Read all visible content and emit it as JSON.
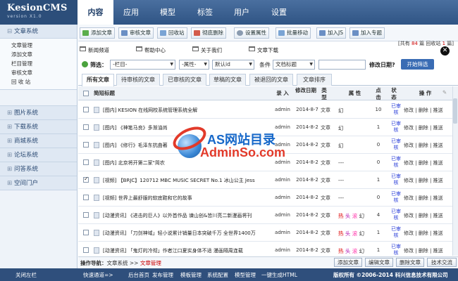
{
  "app": {
    "name": "KesionCMS",
    "version": "version X1.0"
  },
  "nav": {
    "tabs": [
      "内容",
      "应用",
      "模型",
      "标签",
      "用户",
      "设置"
    ],
    "active": "内容"
  },
  "sidebar": {
    "sections": [
      {
        "label": "文章系统",
        "items": [
          "文章管理",
          "添加文章",
          "栏目管理",
          "审核文章",
          "回 收 站"
        ]
      },
      {
        "label": "图片系统"
      },
      {
        "label": "下载系统"
      },
      {
        "label": "商城系统"
      },
      {
        "label": "论坛系统"
      },
      {
        "label": "问答系统"
      },
      {
        "label": "空间门户"
      }
    ]
  },
  "toolbar": {
    "buttons": [
      "添加文章",
      "审核文章",
      "回收站",
      "彻底删除",
      "设置属性",
      "批量移动",
      "加入JS",
      "加入专题"
    ],
    "stats": {
      "pre": "[共有 ",
      "total": "84",
      "mid": " 篇 回收站 ",
      "recycle": "1",
      "post": " 篇]"
    }
  },
  "folders": [
    "新闻频道",
    "帮助中心",
    "关于我们",
    "文章下载"
  ],
  "filter": {
    "label": "筛选：",
    "category": "-栏目-",
    "attr": "-属性-",
    "order": "默认id",
    "cond_label": "条件",
    "cond": "文档标题",
    "modify_label": "修改日期?",
    "button": "开始筛选"
  },
  "status_tabs": [
    "所有文章",
    "待审核的文章",
    "已审核的文章",
    "草稿的文章",
    "被退回的文章",
    "文章排序"
  ],
  "table": {
    "headers": {
      "title": "简短标题",
      "entry": "录 入",
      "date": "修改日期",
      "type": "类型",
      "attr": "属 性",
      "hits": "点击",
      "state": "状态",
      "ops": "操 作"
    },
    "rows": [
      {
        "title": "[图内] KESION 在线网校系统管理系统全解",
        "author": "admin",
        "date": "2014-8-7",
        "type": "文章",
        "flags": {
          "hot": "",
          "head": "",
          "roll": "",
          "slide": "幻"
        },
        "hits": "10",
        "state": "已审核",
        "checked": false
      },
      {
        "title": "[图内] 《神笔马良》多渐油尚",
        "author": "admin",
        "date": "2014-8-2",
        "type": "文章",
        "flags": {
          "hot": "",
          "head": "",
          "roll": "",
          "slide": "幻"
        },
        "hits": "1",
        "state": "已审核",
        "checked": false
      },
      {
        "title": "[图内] 《修行》毛泽东抗曲著",
        "author": "admin",
        "date": "2014-8-2",
        "type": "文章",
        "flags": {
          "hot": "",
          "head": "",
          "roll": "",
          "slide": "幻"
        },
        "hits": "0",
        "state": "已审核",
        "checked": false
      },
      {
        "title": "[图内] 北京将开第二家\"简农",
        "author": "admin",
        "date": "2014-8-2",
        "type": "文章",
        "flags": {
          "hot": "",
          "head": "",
          "roll": "",
          "slide": "---"
        },
        "hits": "0",
        "state": "已审核",
        "checked": false
      },
      {
        "title": "[视频] 【BRJC】120712 MBC MUSIC SECRET No.1 冰山公主 Jess",
        "author": "admin",
        "date": "2014-8-2",
        "type": "文章",
        "flags": {
          "hot": "",
          "head": "",
          "roll": "",
          "slide": "---"
        },
        "hits": "1",
        "state": "已审核",
        "checked": true
      },
      {
        "title": "[视频] 世界上最舒服的软底鞋和它的故事",
        "author": "admin",
        "date": "2014-8-2",
        "type": "文章",
        "flags": {
          "hot": "",
          "head": "",
          "roll": "",
          "slide": "---"
        },
        "hits": "0",
        "state": "已审核",
        "checked": false
      },
      {
        "title": "[动漫资讯] 《进击的巨人》以外首作品 谏山创&皆川亮二新漫画将刊",
        "author": "admin",
        "date": "2014-8-2",
        "type": "文章",
        "flags": {
          "hot": "热",
          "head": "头",
          "roll": "滚",
          "slide": "幻"
        },
        "hits": "4",
        "state": "已审核",
        "checked": false
      },
      {
        "title": "[动漫资讯] 「刀剑神域」轻小说累计销量日本突破千万 全世界1400万",
        "author": "admin",
        "date": "2014-8-2",
        "type": "文章",
        "flags": {
          "hot": "热",
          "head": "头",
          "roll": "滚",
          "slide": "幻"
        },
        "hits": "1",
        "state": "已审核",
        "checked": false
      },
      {
        "title": "[动漫资讯] 「鬼灯的冷彻」作者江口夏实身体不适 漫画隔周连载",
        "author": "admin",
        "date": "2014-8-2",
        "type": "文章",
        "flags": {
          "hot": "热",
          "head": "头",
          "roll": "滚",
          "slide": "幻"
        },
        "hits": "1",
        "state": "已审核",
        "checked": false
      }
    ],
    "ops": {
      "edit": "修改",
      "sep": " | ",
      "del": "删除",
      "push": "推送"
    }
  },
  "bottom_nav": {
    "label": "操作导航：",
    "path": "文章系统",
    "arrow": " >> ",
    "current": "文章管理",
    "buttons": [
      "添加文章",
      "编辑文章",
      "删除文章",
      "技术交流"
    ]
  },
  "footer": {
    "left": "关闭左栏",
    "links_label": "快速通道=>",
    "links": [
      "后台首页",
      "发布管理",
      "模板管理",
      "系统配置",
      "模型管理",
      "一键生成HTML"
    ],
    "copyright": "版权所有 ©2006-2014 科兴信息技术有限公司"
  },
  "watermark": {
    "line1": "AS网站目录",
    "line2": "AdminSo.com"
  },
  "colors": {
    "header": "#3a5f8f",
    "accent_blue": "#3a6cb4",
    "state_blue": "#2a3ed8",
    "hot_red": "#d00"
  }
}
